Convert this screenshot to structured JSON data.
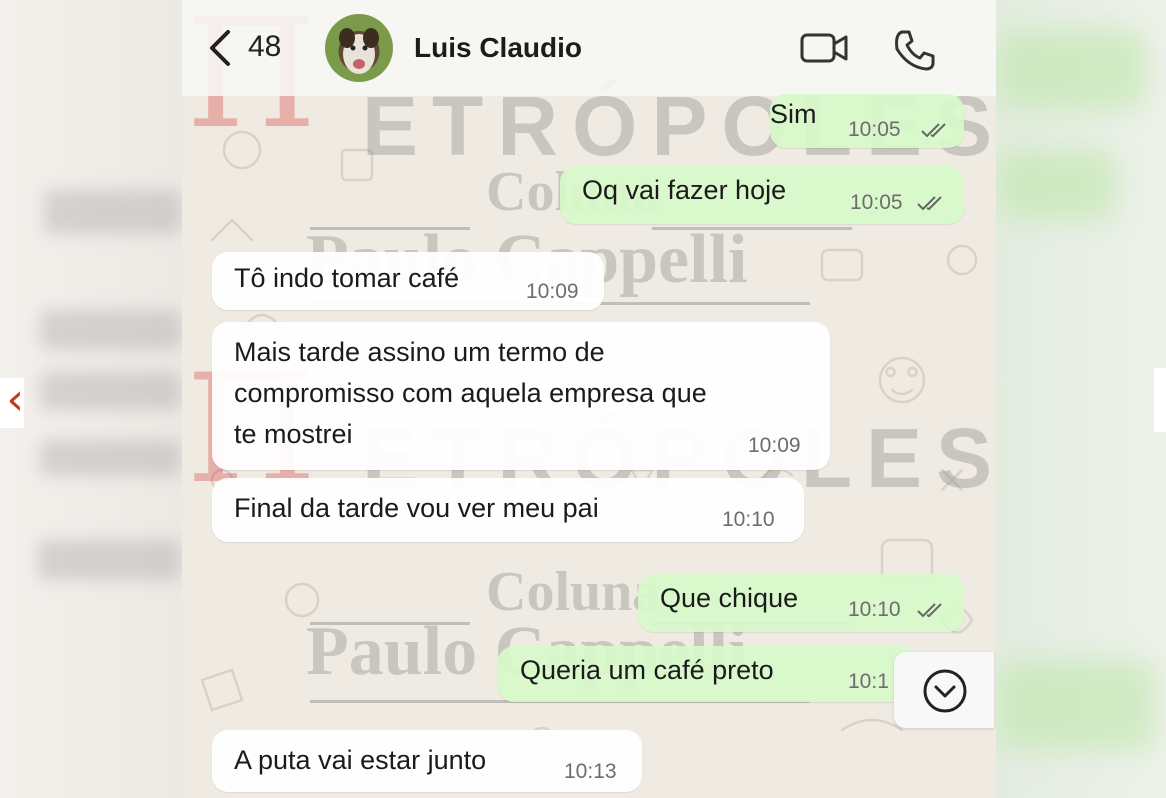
{
  "header": {
    "back_count": "48",
    "contact_name": "Luis Claudio"
  },
  "watermark": {
    "brand_suffix": "ETRÓPOLES",
    "column_word": "Coluna",
    "author": "Paulo Cappelli"
  },
  "messages": [
    {
      "direction": "outgoing",
      "text": "Sim",
      "time": "10:05",
      "read": true
    },
    {
      "direction": "outgoing",
      "text": "Oq vai fazer hoje",
      "time": "10:05",
      "read": true
    },
    {
      "direction": "incoming",
      "text": "Tô indo tomar café",
      "time": "10:09"
    },
    {
      "direction": "incoming",
      "lines": [
        "Mais tarde assino um termo de",
        "compromisso com aquela empresa que",
        "te mostrei"
      ],
      "time": "10:09"
    },
    {
      "direction": "incoming",
      "text": "Final da tarde vou ver meu pai",
      "time": "10:10"
    },
    {
      "direction": "outgoing",
      "text": "Que chique",
      "time": "10:10",
      "read": true
    },
    {
      "direction": "outgoing",
      "text": "Queria um café preto",
      "time": "10:1"
    },
    {
      "direction": "incoming",
      "text": "A puta vai estar junto",
      "time": "10:13"
    }
  ],
  "icons": {
    "back": "chevron-left-icon",
    "video": "video-camera-icon",
    "call": "phone-icon",
    "scroll": "chevron-down-circle-icon",
    "read_receipt": "double-check-icon"
  },
  "colors": {
    "outgoing_bubble": "#d7f8ca",
    "incoming_bubble": "#ffffff",
    "chat_background": "#efeae2",
    "watermark_red": "#d63232"
  }
}
